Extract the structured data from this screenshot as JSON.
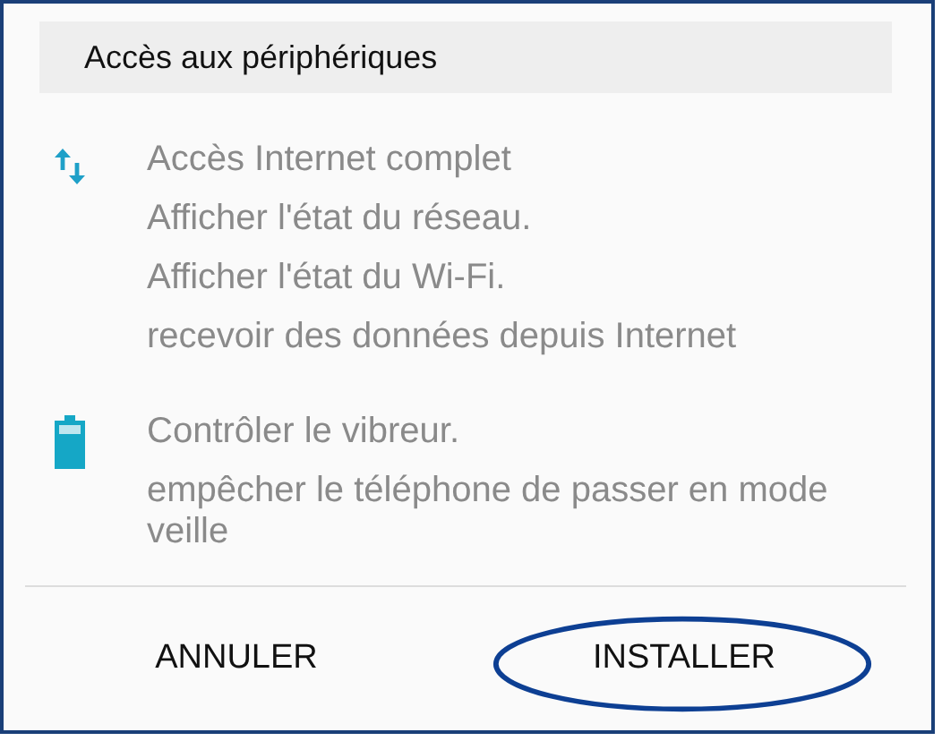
{
  "section": {
    "title": "Accès aux périphériques"
  },
  "groups": [
    {
      "kind": "arrows",
      "items": [
        "Accès Internet complet",
        "Afficher l'état du réseau.",
        "Afficher l'état du Wi-Fi.",
        "recevoir des données depuis Internet"
      ]
    },
    {
      "kind": "battery",
      "items": [
        "Contrôler le vibreur.",
        "empêcher le téléphone de passer en mode veille"
      ]
    }
  ],
  "buttons": [
    {
      "label": "ANNULER",
      "highlighted": false
    },
    {
      "label": "INSTALLER",
      "highlighted": true
    }
  ]
}
